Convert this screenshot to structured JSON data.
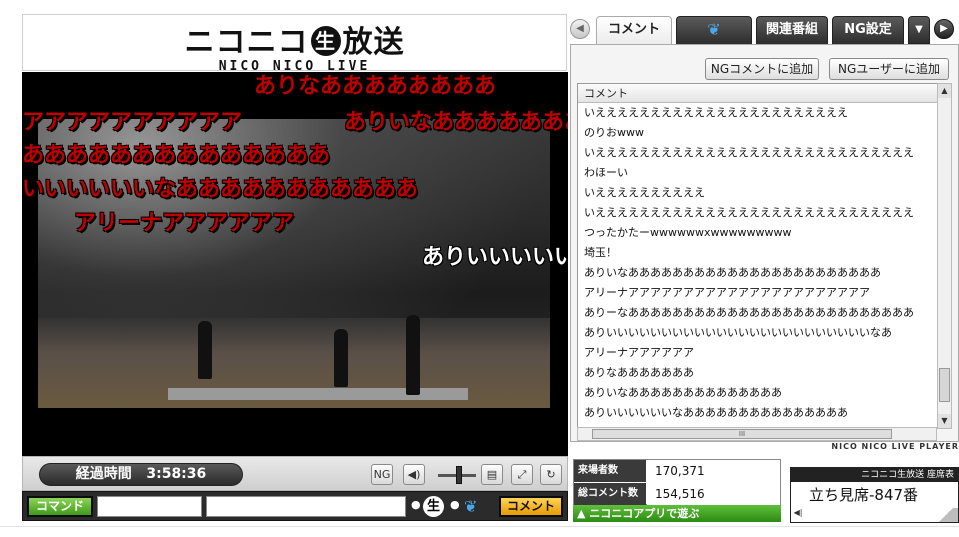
{
  "logo": {
    "main_left": "ニコニコ",
    "nama": "生",
    "main_right": "放送",
    "sub": "NICO NICO LIVE"
  },
  "video": {
    "danmaku": [
      {
        "text": "ありなああああああああ",
        "color": "red"
      },
      {
        "text": "アアアアアアアアアア",
        "color": "red"
      },
      {
        "text": "ありいなああああああああ",
        "color": "red"
      },
      {
        "text": "ああああああああああああああ",
        "color": "red"
      },
      {
        "text": "いいいいいいなあああああああああああ",
        "color": "red"
      },
      {
        "text": "アリーナアアアアアア",
        "color": "red"
      },
      {
        "text": "ありいいいいい",
        "color": "white"
      }
    ]
  },
  "controls": {
    "elapsed_label": "経過時間",
    "elapsed_time": "3:58:36",
    "icons": [
      "ng-share-icon",
      "speaker-icon",
      "comment-toggle-icon",
      "popout-icon",
      "reload-icon"
    ]
  },
  "input": {
    "command_label": "コマンド",
    "nama_label": "生",
    "submit_label": "コメント"
  },
  "tabs": {
    "items": [
      "コメント",
      "Twitter",
      "関連番組",
      "NG設定"
    ],
    "active": 0
  },
  "ng_buttons": {
    "add_comment": "NGコメントに追加",
    "add_user": "NGユーザーに追加"
  },
  "comments": {
    "header": "コメント",
    "rows": [
      "いえええええええええええええええええええええええ",
      "のりおwww",
      "いえええええええええええええええええええええええええええええ",
      "わほーい",
      "いええええええええええ",
      "いえええええええええええええええええええええええええええええ",
      "つったかたーwwwwwwxwwwwwwwww",
      "埼玉！",
      "ありいなあああああああああああああああああああああああ",
      "アリーナアアアアアアアアアアアアアアアアアアアアアア",
      "ありーなああああああああああああああああああああああああああ",
      "ありいいいいいいいいいいいいいいいいいいいいいいいいなあ",
      "アリーナアアアアアア",
      "ありなあああああああ",
      "ありいなああああああああああああああ",
      "ありいいいいいいなあああああああああああああああ"
    ],
    "hscroll_label": "III"
  },
  "panel_footer": "NICO NICO LIVE PLAYER",
  "stats": {
    "visitors_label": "来場者数",
    "visitors_value": "170,371",
    "comments_label": "総コメント数",
    "comments_value": "154,516"
  },
  "app_button": "▲ ニコニコアプリで遊ぶ",
  "seat": {
    "title": "ニコニコ生放送 座席表",
    "value": "立ち見席-847番"
  },
  "colors": {
    "danmaku_red": "#c00000",
    "command_green": "#3f9a1a",
    "submit_orange": "#e69a00",
    "twitter_blue": "#4aa8e8"
  }
}
